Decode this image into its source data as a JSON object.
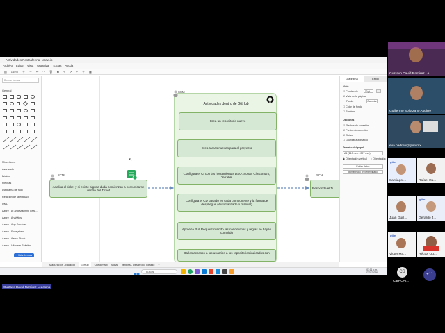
{
  "window": {
    "title": "Actividades Postcafeena - draw.io",
    "menu": [
      "Archivo",
      "Editar",
      "Vista",
      "Organizar",
      "Extras",
      "Ayuda"
    ],
    "zoom": "165%"
  },
  "left_panel": {
    "search_placeholder": "Buscar formas",
    "general": "General",
    "sections": [
      "Misceláneo",
      "Avanzado",
      "Básico",
      "Flechas",
      "Diagrama de flujo",
      "Relación de la entidad",
      "UML",
      "Azure / AI and Machine Lear...",
      "Azure / Analytics",
      "Azure / App Services",
      "Azure / Ecosystem",
      "Azure / Azure Stack",
      "Azure / VMware Solution"
    ],
    "more_shapes": "+ Más formas"
  },
  "diagram": {
    "panel_title": "Actividades dentro de GitHub",
    "scm_label": "SCM",
    "left_node": "Analisa el ticket y si existe alguna duda comienzan a comunicarse dentro del Ticket",
    "right_node": "Responde el Ti...",
    "steps": [
      "Crea un repositorio nuevo",
      "Crea ramas nuevas para el proyecto",
      "Configura el CI con las herramientas DSO: Sonar, Checkmarx, Terrable",
      "Configura el CD basado en cada componente y la forma de despliegue (Automatizado o manual)",
      "Aprueba Pull Request cuando las condiciones y reglas se hayan cumplido",
      "Da los accesos a los usuarios a los repositorios indicados con"
    ]
  },
  "right_panel": {
    "tabs": [
      "Diagrama",
      "Estilo"
    ],
    "view_header": "Vista",
    "grid": "Cuadrícula",
    "grid_size": "10 pt",
    "page_view": "Vista de la página",
    "background": "Fondo",
    "change": "Cambiar",
    "bg_color": "Color de fondo",
    "shadow": "Sombra",
    "options_header": "Opciones",
    "options": [
      "Flechas de conexión",
      "Puntos de conexión",
      "Guías",
      "Guardar automático"
    ],
    "paper_header": "Tamaño del papel",
    "paper_size": "A4 (210 mm x 297 mm)",
    "portrait": "Orientación vertical",
    "landscape": "Orientación",
    "edit_data": "Editar datos",
    "clear_default": "Borrar estilo predeterminado"
  },
  "bottom_tabs": [
    "Maduración - Backlog",
    "GitHub",
    "Checkmarx",
    "Sonar",
    "Jenkins - Desarrollo Torrado",
    "+"
  ],
  "taskbar": {
    "search": "Buscar",
    "time": "03:11 p.m.",
    "date": "07/07/2026"
  },
  "participants": [
    {
      "name": "Gustavo David Ramirez Le..."
    },
    {
      "name": "Guillermo Solorzano Aguirre"
    },
    {
      "name": "eva.padron@gtim.mx"
    },
    {
      "name": "Santiago ..."
    },
    {
      "name": "Rafael Ra..."
    },
    {
      "name": "Juan Guill..."
    },
    {
      "name": "Gerardo J..."
    },
    {
      "name": "Victor Ma..."
    },
    {
      "name": "Héctor Qu..."
    },
    {
      "name": "CarRCAI...",
      "initials": "CS"
    },
    {
      "name": "+11"
    }
  ],
  "active_speaker": "Gustavo David Ramirez Ledesma",
  "colors": {
    "node_fill": "#d5e8d4",
    "node_border": "#82b366",
    "arrow": "#6c8ebf",
    "panel_fill": "#eaf5e6"
  }
}
